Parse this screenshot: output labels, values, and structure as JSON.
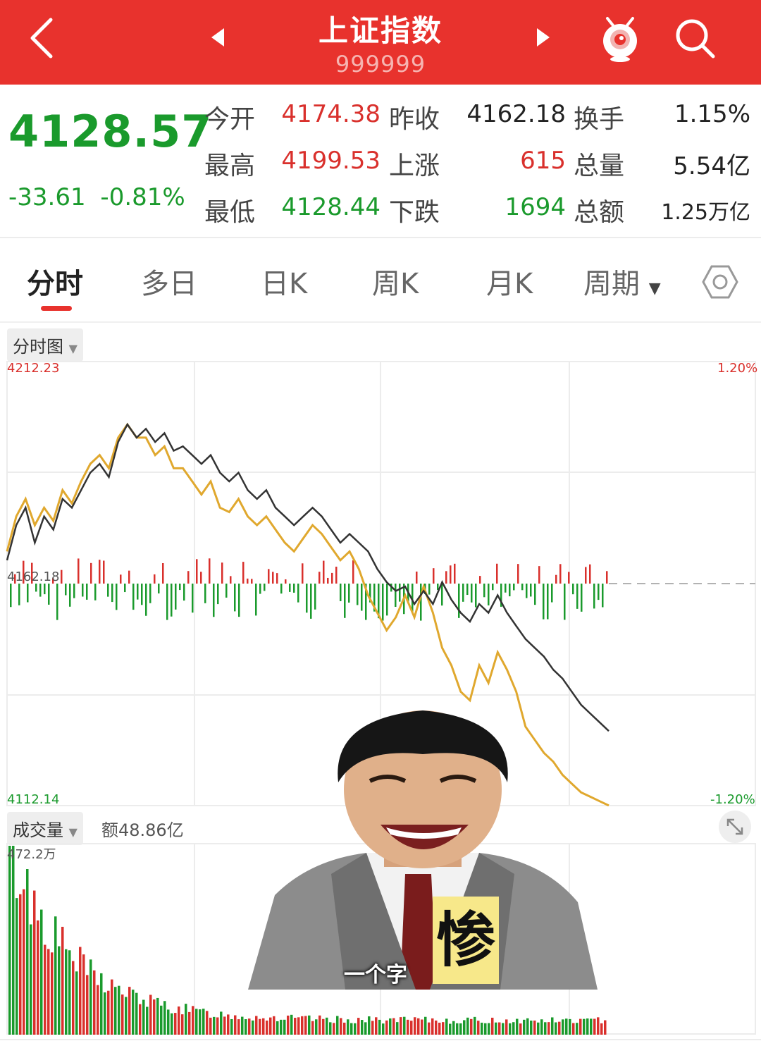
{
  "header": {
    "title": "上证指数",
    "code": "999999",
    "icons": [
      "back-arrow-icon",
      "prev-arrow-icon",
      "next-arrow-icon",
      "mascot-icon",
      "search-icon"
    ]
  },
  "quote": {
    "price": "4128.57",
    "change": "-33.61",
    "change_pct": "-0.81%",
    "rows": [
      {
        "l1": "今开",
        "v1": "4174.38",
        "l2": "昨收",
        "v2": "4162.18",
        "l3": "换手",
        "v3": "1.15%"
      },
      {
        "l1": "最高",
        "v1": "4199.53",
        "l2": "上涨",
        "v2": "615",
        "l3": "总量",
        "v3": "5.54亿"
      },
      {
        "l1": "最低",
        "v1": "4128.44",
        "l2": "下跌",
        "v2": "1694",
        "l3": "总额",
        "v3": "1.25万亿"
      }
    ]
  },
  "tabs": [
    "分时",
    "多日",
    "日K",
    "周K",
    "月K",
    "周期"
  ],
  "chart": {
    "selector": "分时图",
    "y_max": "4212.23",
    "y_min": "4112.14",
    "prev_close": "4162.18",
    "pct_max": "1.20%",
    "pct_min": "-1.20%"
  },
  "volume": {
    "selector": "成交量",
    "amount": "额48.86亿",
    "max": "472.2万"
  },
  "sticker": {
    "caption": "一个字",
    "big_char": "惨"
  },
  "colors": {
    "up": "#d9302c",
    "down": "#1a9a2c",
    "header": "#e8322d"
  },
  "chart_data": {
    "type": "line",
    "ylim": [
      4112.14,
      4212.23
    ],
    "series": [
      {
        "values": [
          4168,
          4176,
          4180,
          4172,
          4178,
          4175,
          4182,
          4180,
          4184,
          4188,
          4190,
          4187,
          4195,
          4199,
          4196,
          4198,
          4195,
          4197,
          4193,
          4194,
          4192,
          4190,
          4192,
          4188,
          4186,
          4188,
          4184,
          4182,
          4184,
          4180,
          4178,
          4176,
          4178,
          4180,
          4178,
          4175,
          4172,
          4174,
          4172,
          4170,
          4166,
          4163,
          4161,
          4162,
          4158,
          4161,
          4158,
          4163,
          4159,
          4156,
          4154,
          4158,
          4156,
          4160,
          4156,
          4153,
          4150,
          4148,
          4146,
          4143,
          4141,
          4138,
          4135,
          4133,
          4131,
          4129
        ]
      },
      {
        "values": [
          4170,
          4178,
          4182,
          4176,
          4180,
          4177,
          4184,
          4181,
          4186,
          4190,
          4192,
          4189,
          4196,
          4199,
          4196,
          4196,
          4192,
          4194,
          4189,
          4189,
          4186,
          4183,
          4186,
          4180,
          4179,
          4182,
          4178,
          4176,
          4178,
          4175,
          4172,
          4170,
          4173,
          4176,
          4174,
          4171,
          4168,
          4170,
          4166,
          4160,
          4156,
          4152,
          4155,
          4160,
          4155,
          4162,
          4156,
          4148,
          4144,
          4138,
          4136,
          4144,
          4140,
          4147,
          4143,
          4138,
          4130,
          4127,
          4124,
          4122,
          4119,
          4117,
          4115,
          4114,
          4113,
          4112
        ]
      }
    ]
  }
}
